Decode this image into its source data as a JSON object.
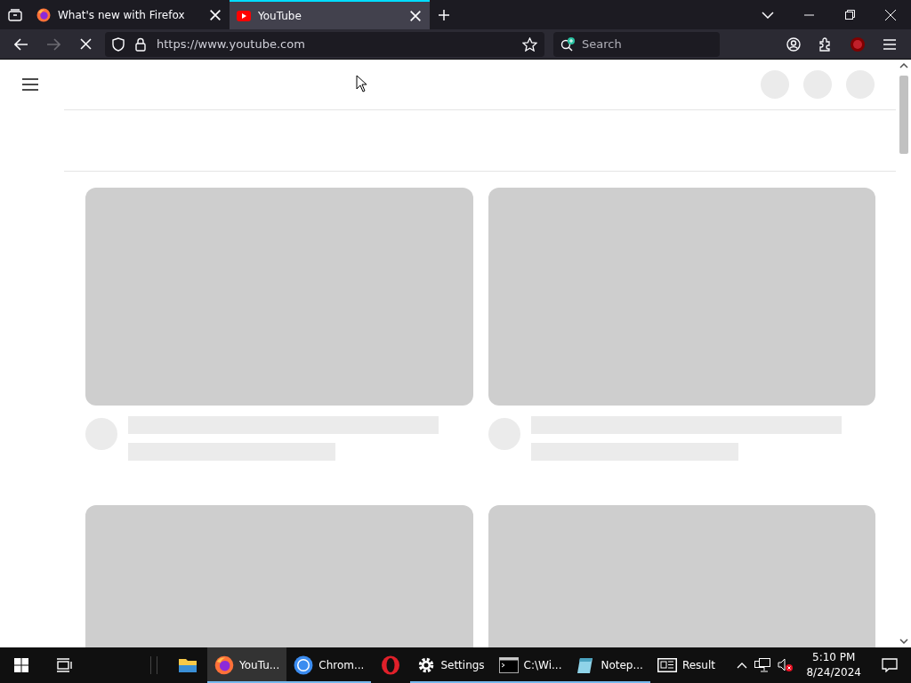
{
  "tabs": [
    {
      "title": "What's new with Firefox",
      "selected": false,
      "kind": "firefox"
    },
    {
      "title": "YouTube",
      "selected": true,
      "kind": "youtube"
    }
  ],
  "toolbar": {
    "url": "https://www.youtube.com",
    "search_placeholder": "Search",
    "forward_disabled": true,
    "loading": true
  },
  "taskbar": {
    "items": [
      {
        "kind": "explorer",
        "running": false,
        "active": false
      },
      {
        "kind": "firefox",
        "label": "YouTu...",
        "running": true,
        "active": true
      },
      {
        "kind": "chrome",
        "label": "Chrom...",
        "running": true,
        "active": false
      },
      {
        "kind": "opera",
        "running": false,
        "active": false
      },
      {
        "kind": "settings",
        "label": "Settings",
        "running": true,
        "active": false
      },
      {
        "kind": "terminal",
        "label": "C:\\Wi...",
        "running": true,
        "active": false
      },
      {
        "kind": "notepad",
        "label": "Notep...",
        "running": true,
        "active": false
      },
      {
        "kind": "news",
        "label": "Result",
        "running": false,
        "active": false
      }
    ],
    "time": "5:10 PM",
    "date": "8/24/2024",
    "volume_muted": true
  }
}
